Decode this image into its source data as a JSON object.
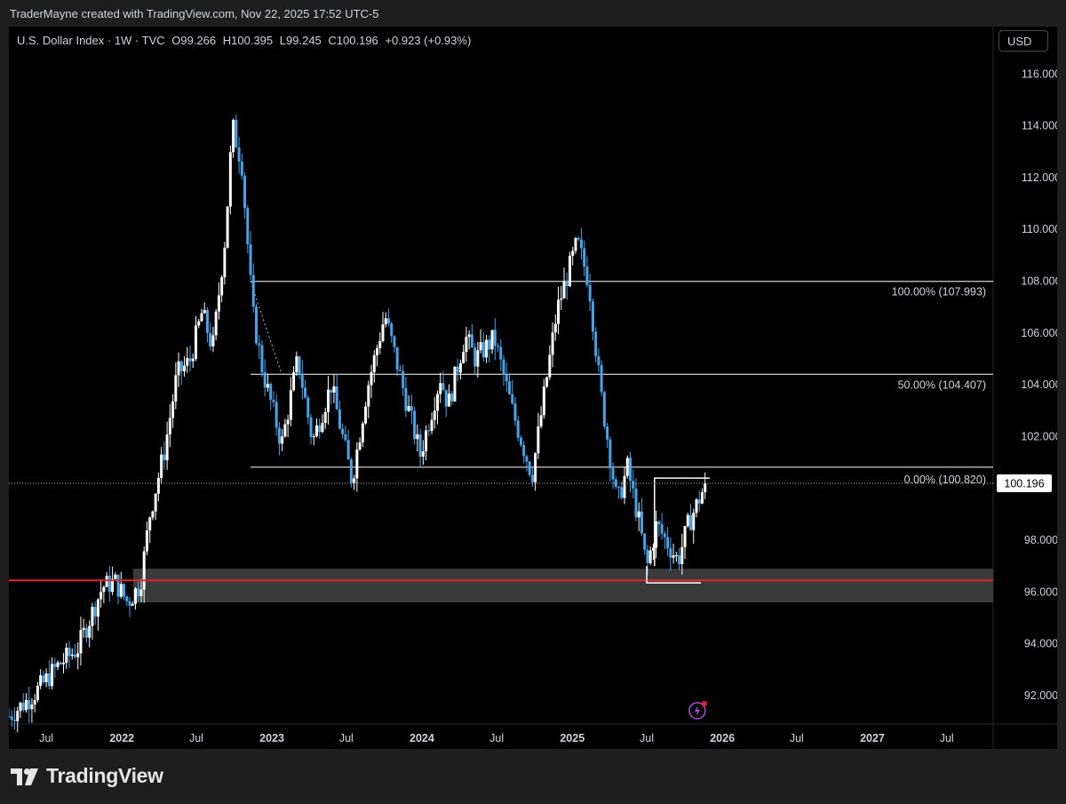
{
  "header": {
    "credit": "TraderMayne created with TradingView.com, Nov 22, 2025 17:52 UTC-5"
  },
  "legend": {
    "symbol": "U.S. Dollar Index · 1W · TVC",
    "open": "O99.266",
    "high": "H100.395",
    "low": "L99.245",
    "close": "C100.196",
    "change": "+0.923 (+0.93%)"
  },
  "currency_button": "USD",
  "footer": {
    "brand": "TradingView"
  },
  "colors": {
    "up": "#ffffff",
    "down": "#4aa3e8",
    "support_line": "#e5232b",
    "zone": "#3a3a3a",
    "fib_line": "#ffffff"
  },
  "chart_data": {
    "type": "candlestick",
    "title": "U.S. Dollar Index · 1W · TVC",
    "ylim": [
      90.9,
      116.8
    ],
    "y_ticks": [
      "92.000",
      "94.000",
      "96.000",
      "98.000",
      "100.000",
      "102.000",
      "104.000",
      "106.000",
      "108.000",
      "110.000",
      "112.000",
      "114.000",
      "116.000"
    ],
    "x_range": [
      "2021-04-01",
      "2027-10-22"
    ],
    "x_ticks": [
      {
        "label": "Jul",
        "date": "2021-07-01",
        "bold": false
      },
      {
        "label": "2022",
        "date": "2022-01-01",
        "bold": true
      },
      {
        "label": "Jul",
        "date": "2022-07-01",
        "bold": false
      },
      {
        "label": "2023",
        "date": "2023-01-01",
        "bold": true
      },
      {
        "label": "Jul",
        "date": "2023-07-01",
        "bold": false
      },
      {
        "label": "2024",
        "date": "2024-01-01",
        "bold": true
      },
      {
        "label": "Jul",
        "date": "2024-07-01",
        "bold": false
      },
      {
        "label": "2025",
        "date": "2025-01-01",
        "bold": true
      },
      {
        "label": "Jul",
        "date": "2025-07-01",
        "bold": false
      },
      {
        "label": "2026",
        "date": "2026-01-01",
        "bold": true
      },
      {
        "label": "Jul",
        "date": "2026-07-01",
        "bold": false
      },
      {
        "label": "2027",
        "date": "2027-01-01",
        "bold": true
      },
      {
        "label": "Jul",
        "date": "2027-07-01",
        "bold": false
      }
    ],
    "price_path": [
      [
        "2021-04-01",
        91.2
      ],
      [
        "2021-05-15",
        91.8
      ],
      [
        "2021-06-15",
        92.3
      ],
      [
        "2021-08-01",
        93.2
      ],
      [
        "2021-09-15",
        93.8
      ],
      [
        "2021-11-15",
        96.2
      ],
      [
        "2021-12-15",
        96.4
      ],
      [
        "2022-01-15",
        95.6
      ],
      [
        "2022-02-15",
        96.3
      ],
      [
        "2022-03-10",
        99.0
      ],
      [
        "2022-04-15",
        101.5
      ],
      [
        "2022-05-15",
        104.4
      ],
      [
        "2022-06-15",
        104.9
      ],
      [
        "2022-07-15",
        106.8
      ],
      [
        "2022-08-10",
        105.4
      ],
      [
        "2022-09-10",
        109.8
      ],
      [
        "2022-09-27",
        114.0
      ],
      [
        "2022-10-20",
        112.5
      ],
      [
        "2022-11-15",
        106.8
      ],
      [
        "2022-12-10",
        104.5
      ],
      [
        "2023-01-25",
        101.7
      ],
      [
        "2023-03-05",
        105.0
      ],
      [
        "2023-04-10",
        101.8
      ],
      [
        "2023-05-25",
        104.0
      ],
      [
        "2023-07-15",
        100.3
      ],
      [
        "2023-08-20",
        103.8
      ],
      [
        "2023-10-03",
        106.7
      ],
      [
        "2023-11-25",
        103.3
      ],
      [
        "2023-12-28",
        101.3
      ],
      [
        "2024-02-15",
        104.3
      ],
      [
        "2024-03-05",
        103.2
      ],
      [
        "2024-04-15",
        105.9
      ],
      [
        "2024-05-10",
        105.0
      ],
      [
        "2024-06-25",
        105.8
      ],
      [
        "2024-08-10",
        102.9
      ],
      [
        "2024-09-25",
        100.5
      ],
      [
        "2024-10-30",
        104.2
      ],
      [
        "2024-11-25",
        106.9
      ],
      [
        "2025-01-13",
        109.5
      ],
      [
        "2025-02-10",
        108.0
      ],
      [
        "2025-03-10",
        103.8
      ],
      [
        "2025-04-20",
        99.4
      ],
      [
        "2025-05-15",
        100.8
      ],
      [
        "2025-06-15",
        98.5
      ],
      [
        "2025-07-01",
        96.9
      ],
      [
        "2025-07-25",
        98.6
      ],
      [
        "2025-08-20",
        97.9
      ],
      [
        "2025-09-15",
        97.2
      ],
      [
        "2025-10-10",
        98.6
      ],
      [
        "2025-11-22",
        100.2
      ]
    ],
    "last_price": 100.196,
    "annotations": [
      {
        "type": "fib_level",
        "label": "100.00% (107.993)",
        "value": 107.993
      },
      {
        "type": "fib_level",
        "label": "50.00% (104.407)",
        "value": 104.407
      },
      {
        "type": "fib_level",
        "label": "0.00% (100.820)",
        "value": 100.82
      },
      {
        "type": "horizontal_line",
        "value": 96.45,
        "color": "red"
      },
      {
        "type": "zone",
        "from": 95.6,
        "to": 96.9
      },
      {
        "type": "range_box",
        "from_date": "2025-07-20",
        "to_date": "2025-12-01",
        "top": 100.4
      },
      {
        "type": "bracket",
        "from_date": "2025-07-01",
        "to_date": "2025-11-10",
        "value": 96.35
      }
    ]
  }
}
